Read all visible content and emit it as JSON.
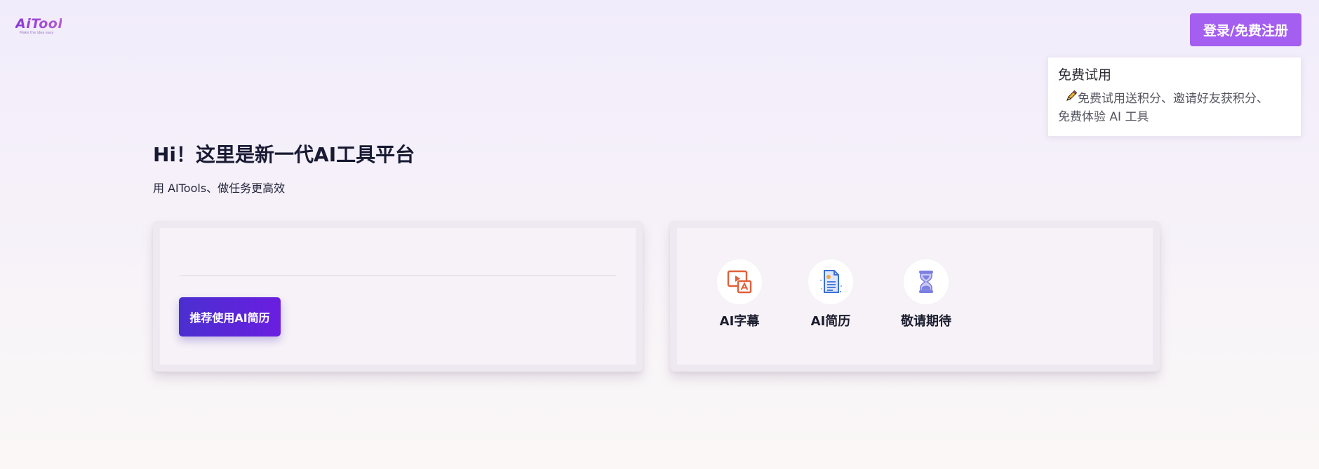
{
  "header": {
    "logo_text": "AiTools",
    "logo_tagline": "Make the idea easy",
    "login_label": "登录/免费注册"
  },
  "popover": {
    "title": "免费试用",
    "body_line1": "免费试用送积分、邀请好友获积分、",
    "body_line2": "免费体验 AI 工具"
  },
  "hero": {
    "title": "Hi！这里是新一代AI工具平台",
    "subtitle": "用 AITools、做任务更高效"
  },
  "left_card": {
    "button_label": "推荐使用AI简历"
  },
  "tools": [
    {
      "label": "AI字幕",
      "icon": "subtitle-icon"
    },
    {
      "label": "AI简历",
      "icon": "resume-icon"
    },
    {
      "label": "敬请期待",
      "icon": "hourglass-icon"
    }
  ],
  "colors": {
    "accent": "#a45ef0",
    "primary_button": "#5a27d8",
    "subtitle_icon": "#e0603a",
    "resume_icon": "#3a6fd8",
    "hourglass_icon": "#7b7fe0"
  }
}
